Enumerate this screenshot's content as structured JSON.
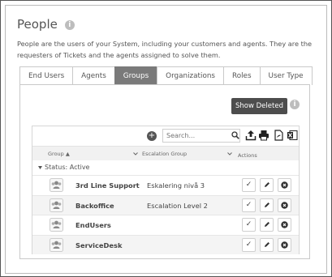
{
  "page": {
    "title": "People",
    "description": "People are the users of your System, including your customers and agents. They are the requesters of Tickets and the agents assigned to solve them."
  },
  "tabs": [
    {
      "label": "End Users",
      "active": false
    },
    {
      "label": "Agents",
      "active": false
    },
    {
      "label": "Groups",
      "active": true
    },
    {
      "label": "Organizations",
      "active": false
    },
    {
      "label": "Roles",
      "active": false
    },
    {
      "label": "User Type",
      "active": false
    }
  ],
  "panel": {
    "show_deleted_label": "Show Deleted"
  },
  "toolbar": {
    "search_placeholder": "Search..."
  },
  "columns": {
    "group": "Group ▲",
    "escalation_group": "Escalation Group",
    "actions": "Actions"
  },
  "status_group": "Status: Active",
  "rows": [
    {
      "name": "3rd Line Support",
      "escalation": "Eskalering nivå 3"
    },
    {
      "name": "Backoffice",
      "escalation": "Escalation Level 2"
    },
    {
      "name": "EndUsers",
      "escalation": ""
    },
    {
      "name": "ServiceDesk",
      "escalation": ""
    }
  ],
  "colors": {
    "active_tab": "#7a7a7a",
    "show_deleted_bg": "#4d4d4d"
  }
}
